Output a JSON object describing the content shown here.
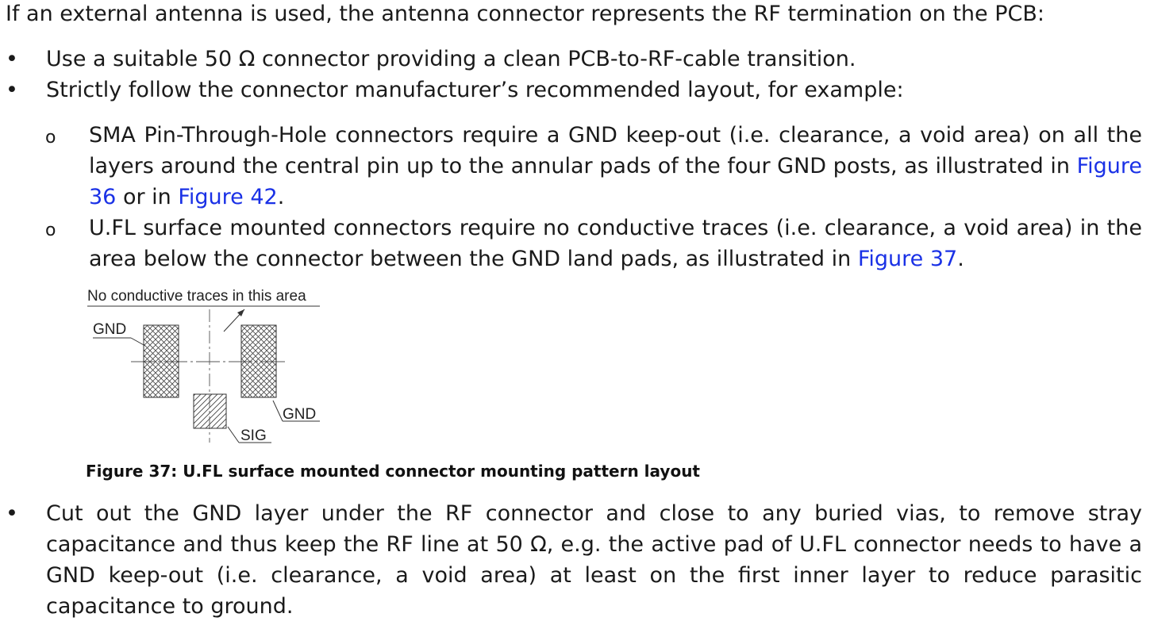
{
  "intro": "If an external antenna is used, the antenna connector represents the RF termination on the PCB:",
  "bullet_symbol": "•",
  "sub_bullet_symbol": "o",
  "bullets": [
    "Use a suitable 50 Ω connector providing a clean PCB-to-RF-cable transition.",
    "Strictly follow the connector manufacturer’s recommended layout, for example:"
  ],
  "sub_items": [
    {
      "text_before": "SMA Pin-Through-Hole connectors require a GND keep-out (i.e. clearance, a void area) on all the layers around the central pin up to the annular pads of the four GND posts, as illustrated in ",
      "link1": "Figure 36",
      "text_mid": " or in ",
      "link2": "Figure 42",
      "text_after": "."
    },
    {
      "text_before": "U.FL surface mounted connectors require no conductive traces (i.e. clearance, a void area) in the area below the connector between the GND land pads, as illustrated in ",
      "link1": "Figure 37",
      "text_after": "."
    }
  ],
  "figure": {
    "label_top": "No conductive traces in this area",
    "label_gnd_left": "GND",
    "label_gnd_right": "GND",
    "label_sig": "SIG",
    "caption": "Figure 37: U.FL surface mounted connector mounting pattern layout"
  },
  "last_bullet": "Cut out the GND layer under the RF connector and close to any buried vias, to remove stray capacitance and thus keep the RF line at 50 Ω, e.g. the active pad of U.FL connector needs to have a GND keep-out (i.e. clearance, a void area) at least on the first inner layer to reduce parasitic capacitance to ground."
}
